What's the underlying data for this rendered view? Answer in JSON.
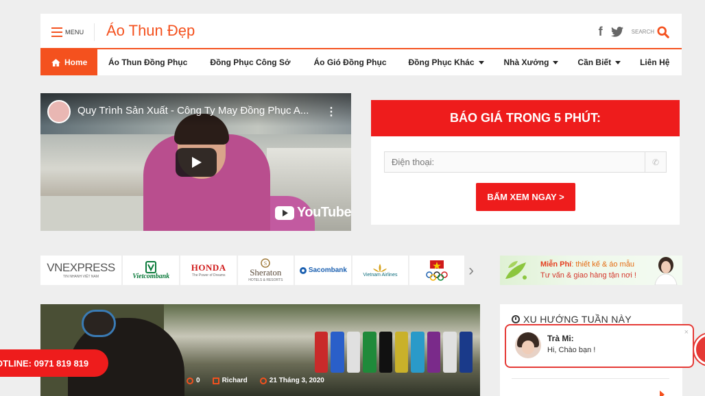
{
  "header": {
    "menu_label": "MENU",
    "site_title": "Áo Thun Đẹp",
    "search_label": "SEARCH"
  },
  "nav": {
    "items": [
      {
        "label": "Home",
        "active": true,
        "dropdown": false
      },
      {
        "label": "Áo Thun Đồng Phục",
        "active": false,
        "dropdown": false
      },
      {
        "label": "Đồng Phục Công Sở",
        "active": false,
        "dropdown": false
      },
      {
        "label": "Áo Gió Đồng Phục",
        "active": false,
        "dropdown": false
      },
      {
        "label": "Đồng Phục Khác",
        "active": false,
        "dropdown": true
      },
      {
        "label": "Nhà Xưởng",
        "active": false,
        "dropdown": true
      },
      {
        "label": "Cần Biết",
        "active": false,
        "dropdown": true
      },
      {
        "label": "Liên Hệ",
        "active": false,
        "dropdown": false
      }
    ]
  },
  "video": {
    "title": "Quy Trình Sản Xuất - Công Ty May Đồng Phục A...",
    "brand": "YouTube"
  },
  "quote": {
    "heading": "BÁO GIÁ TRONG 5 PHÚT:",
    "phone_placeholder": "Điện thoại:",
    "button_label": "BẤM XEM NGAY >"
  },
  "clients": [
    {
      "name": "VNEXPRESS",
      "sub": "TIN NHANH VIỆT NAM"
    },
    {
      "name": "Vietcombank",
      "sub": ""
    },
    {
      "name": "HONDA",
      "sub": "The Power of Dreams"
    },
    {
      "name": "Sheraton",
      "sub": "HOTELS & RESORTS"
    },
    {
      "name": "Sacombank",
      "sub": ""
    },
    {
      "name": "Vietnam Airlines",
      "sub": ""
    },
    {
      "name": "Olympic",
      "sub": ""
    }
  ],
  "promo": {
    "line1_bold": "Miễn Phí",
    "line1_rest": ": thiết kế & áo mẫu",
    "line2": "Tư vấn & giao hàng tận nơi !"
  },
  "feature": {
    "comments": "0",
    "author": "Richard",
    "date": "21 Tháng 3, 2020"
  },
  "sidebar": {
    "title": "XU HƯỚNG TUẦN NÀY"
  },
  "chat": {
    "name": "Trà Mi:",
    "message": "Hi, Chào bạn !",
    "close": "×"
  },
  "hotline": {
    "label": "OTLINE: 0971 819 819"
  },
  "colors": {
    "accent": "#f4511e",
    "red": "#ee1c1c"
  }
}
